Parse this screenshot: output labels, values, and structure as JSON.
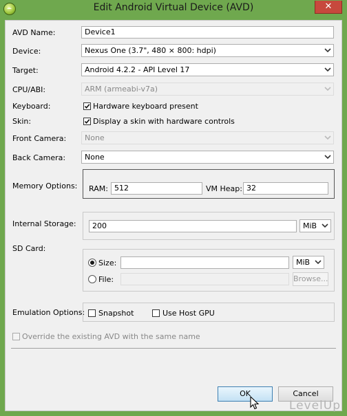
{
  "window": {
    "title": "Edit Android Virtual Device (AVD)",
    "close_glyph": "✕"
  },
  "form": {
    "avd_name": {
      "label": "AVD Name:",
      "value": "Device1"
    },
    "device": {
      "label": "Device:",
      "value": "Nexus One (3.7\", 480 × 800: hdpi)"
    },
    "target": {
      "label": "Target:",
      "value": "Android 4.2.2 - API Level 17"
    },
    "cpu_abi": {
      "label": "CPU/ABI:",
      "value": "ARM (armeabi-v7a)"
    },
    "keyboard": {
      "label": "Keyboard:",
      "checkbox_label": "Hardware keyboard present",
      "checked": true
    },
    "skin": {
      "label": "Skin:",
      "checkbox_label": "Display a skin with hardware controls",
      "checked": true
    },
    "front_camera": {
      "label": "Front Camera:",
      "value": "None"
    },
    "back_camera": {
      "label": "Back Camera:",
      "value": "None"
    },
    "memory": {
      "label": "Memory Options:",
      "ram_label": "RAM:",
      "ram_value": "512",
      "heap_label": "VM Heap:",
      "heap_value": "32"
    },
    "internal_storage": {
      "label": "Internal Storage:",
      "value": "200",
      "unit": "MiB"
    },
    "sd_card": {
      "label": "SD Card:",
      "size_label": "Size:",
      "size_value": "",
      "size_unit": "MiB",
      "file_label": "File:",
      "file_value": "",
      "browse_label": "Browse...",
      "selected": "size"
    },
    "emulation": {
      "label": "Emulation Options:",
      "snapshot_label": "Snapshot",
      "snapshot_checked": false,
      "gpu_label": "Use Host GPU",
      "gpu_checked": false
    },
    "override": {
      "label": "Override the existing AVD with the same name",
      "checked": false
    }
  },
  "buttons": {
    "ok": "OK",
    "cancel": "Cancel"
  },
  "watermark": "LevelUp"
}
